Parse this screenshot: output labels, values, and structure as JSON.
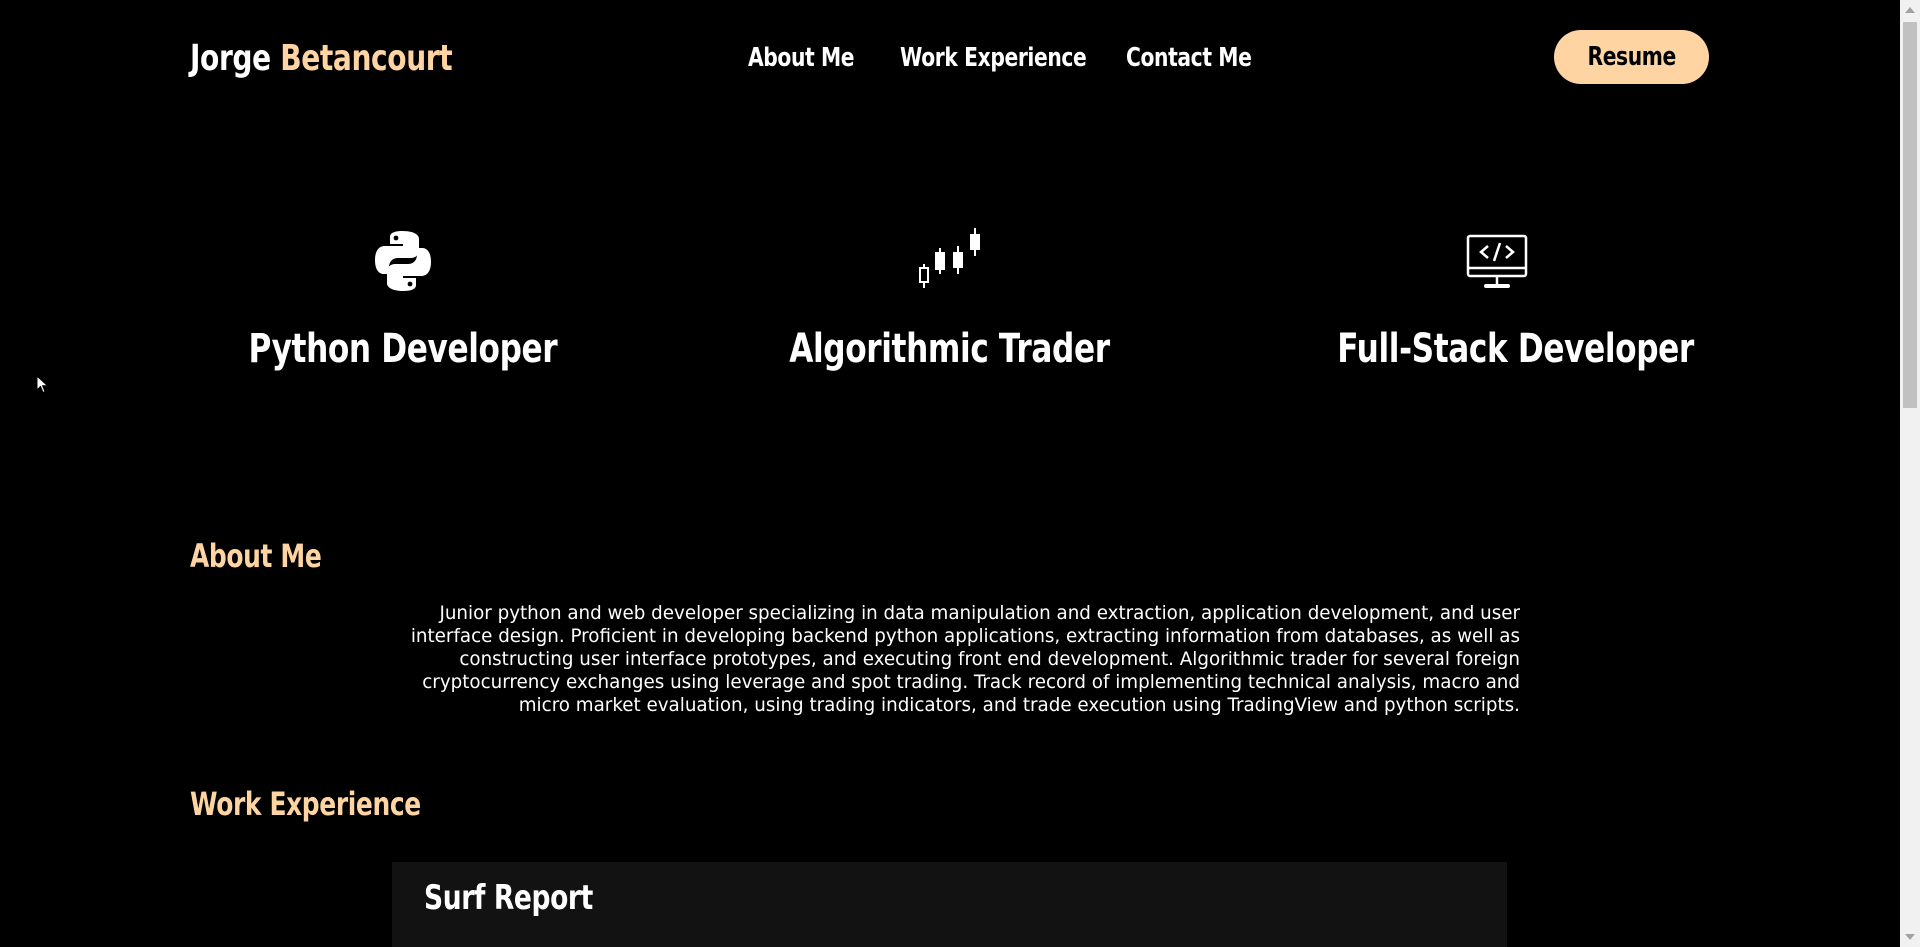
{
  "header": {
    "brand_first": "Jorge",
    "brand_last": "Betancourt",
    "nav": [
      "About Me",
      "Work Experience",
      "Contact Me"
    ],
    "resume_label": "Resume"
  },
  "skills": [
    {
      "icon": "python-icon",
      "title": "Python Developer"
    },
    {
      "icon": "candlestick-chart-icon",
      "title": "Algorithmic Trader"
    },
    {
      "icon": "code-monitor-icon",
      "title": "Full-Stack Developer"
    }
  ],
  "about": {
    "title": "About Me",
    "text": "Junior python and web developer specializing in data manipulation and extraction, application development, and user interface design. Proficient in developing backend python applications, extracting information from databases, as well as constructing user interface prototypes, and executing front end development. Algorithmic trader for several foreign cryptocurrency exchanges using leverage and spot trading. Track record of implementing technical analysis, macro and micro market evaluation, using trading indicators, and trade execution using TradingView and python scripts."
  },
  "work": {
    "title": "Work Experience",
    "cards": [
      {
        "title": "Surf Report"
      }
    ]
  },
  "colors": {
    "background": "#000000",
    "accent": "#ffd4a3",
    "card": "#121212",
    "text": "#ffffff"
  }
}
